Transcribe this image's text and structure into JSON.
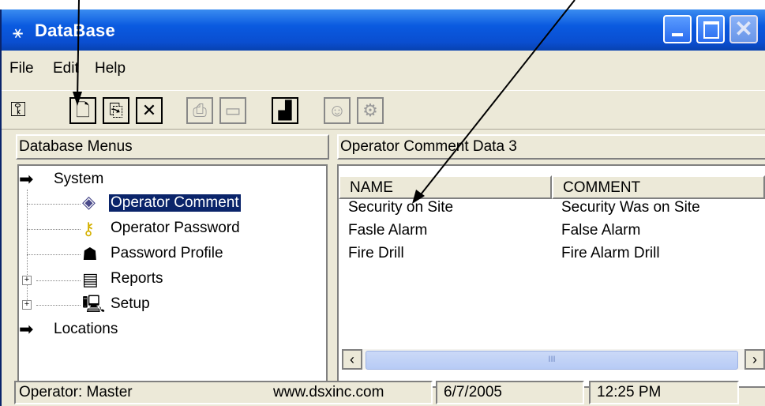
{
  "window": {
    "title": "DataBase",
    "icon": "database-app-icon"
  },
  "menu": [
    "File",
    "Edit",
    "Help"
  ],
  "toolbar": {
    "buttons": [
      {
        "name": "exit-key-icon",
        "glyph": "⚿"
      },
      {
        "name": "new-document-icon",
        "glyph": "🗋"
      },
      {
        "name": "copy-icon",
        "glyph": "⎘"
      },
      {
        "name": "delete-icon",
        "glyph": "✕"
      },
      {
        "name": "print-icon",
        "glyph": "⎙"
      },
      {
        "name": "print-preview-icon",
        "glyph": "▭"
      },
      {
        "name": "chart-icon",
        "glyph": "▟"
      },
      {
        "name": "user-icon",
        "glyph": "☺"
      },
      {
        "name": "user-settings-icon",
        "glyph": "⚙"
      }
    ]
  },
  "left_panel": {
    "header": "Database Menus"
  },
  "tree": {
    "system": "System",
    "operator_comment": "Operator Comment",
    "operator_password": "Operator Password",
    "password_profile": "Password Profile",
    "reports": "Reports",
    "setup": "Setup",
    "locations": "Locations"
  },
  "right_panel": {
    "header": "Operator Comment Data  3"
  },
  "list": {
    "columns": [
      "NAME",
      "COMMENT"
    ],
    "rows": [
      [
        "Security on Site",
        "Security Was on Site"
      ],
      [
        "Fasle Alarm",
        "False Alarm"
      ],
      [
        "Fire Drill",
        "Fire Alarm Drill"
      ]
    ],
    "scroll_thumb": "III"
  },
  "status": {
    "operator": "Operator:  Master",
    "site": "www.dsxinc.com",
    "date": "6/7/2005",
    "time": "12:25 PM"
  }
}
